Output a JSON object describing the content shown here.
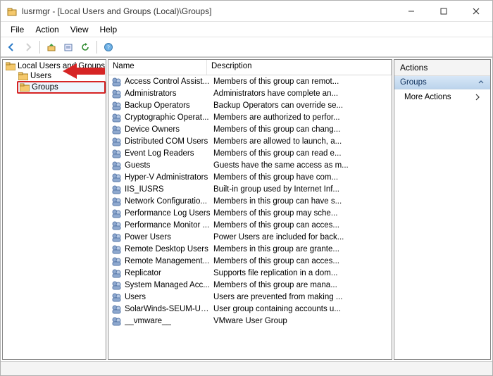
{
  "titlebar": {
    "title": "lusrmgr - [Local Users and Groups (Local)\\Groups]"
  },
  "menubar": [
    "File",
    "Action",
    "View",
    "Help"
  ],
  "tree": {
    "root": "Local Users and Groups (Local)",
    "children": [
      "Users",
      "Groups"
    ],
    "selected_index": 1
  },
  "list": {
    "columns": [
      "Name",
      "Description"
    ],
    "rows": [
      {
        "name": "Access Control Assist...",
        "desc": "Members of this group can remot..."
      },
      {
        "name": "Administrators",
        "desc": "Administrators have complete an..."
      },
      {
        "name": "Backup Operators",
        "desc": "Backup Operators can override se..."
      },
      {
        "name": "Cryptographic Operat...",
        "desc": "Members are authorized to perfor..."
      },
      {
        "name": "Device Owners",
        "desc": "Members of this group can chang..."
      },
      {
        "name": "Distributed COM Users",
        "desc": "Members are allowed to launch, a..."
      },
      {
        "name": "Event Log Readers",
        "desc": "Members of this group can read e..."
      },
      {
        "name": "Guests",
        "desc": "Guests have the same access as m..."
      },
      {
        "name": "Hyper-V Administrators",
        "desc": "Members of this group have com..."
      },
      {
        "name": "IIS_IUSRS",
        "desc": "Built-in group used by Internet Inf..."
      },
      {
        "name": "Network Configuratio...",
        "desc": "Members in this group can have s..."
      },
      {
        "name": "Performance Log Users",
        "desc": "Members of this group may sche..."
      },
      {
        "name": "Performance Monitor ...",
        "desc": "Members of this group can acces..."
      },
      {
        "name": "Power Users",
        "desc": "Power Users are included for back..."
      },
      {
        "name": "Remote Desktop Users",
        "desc": "Members in this group are grante..."
      },
      {
        "name": "Remote Management...",
        "desc": "Members of this group can acces..."
      },
      {
        "name": "Replicator",
        "desc": "Supports file replication in a dom..."
      },
      {
        "name": "System Managed Acc...",
        "desc": "Members of this group are mana..."
      },
      {
        "name": "Users",
        "desc": "Users are prevented from making ..."
      },
      {
        "name": "SolarWinds-SEUM-Us...",
        "desc": "User group containing accounts u..."
      },
      {
        "name": "__vmware__",
        "desc": "VMware User Group"
      }
    ]
  },
  "actions": {
    "header": "Actions",
    "section": "Groups",
    "items": [
      "More Actions"
    ]
  }
}
